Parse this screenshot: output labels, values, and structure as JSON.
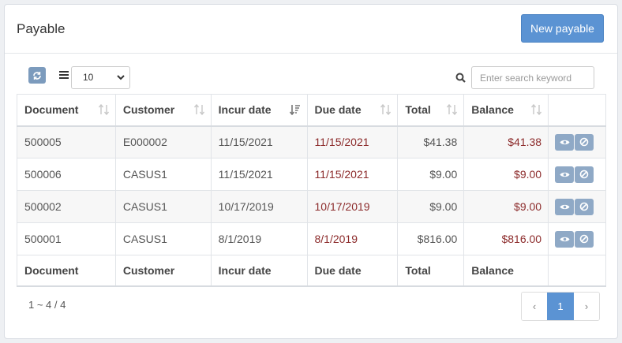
{
  "header": {
    "title": "Payable",
    "new_button_label": "New payable"
  },
  "toolbar": {
    "page_size": "10",
    "search_placeholder": "Enter search keyword"
  },
  "table": {
    "columns": [
      "Document",
      "Customer",
      "Incur date",
      "Due date",
      "Total",
      "Balance"
    ],
    "rows": [
      {
        "document": "500005",
        "customer": "E000002",
        "incur_date": "11/15/2021",
        "due_date": "11/15/2021",
        "total": "$41.38",
        "balance": "$41.38"
      },
      {
        "document": "500006",
        "customer": "CASUS1",
        "incur_date": "11/15/2021",
        "due_date": "11/15/2021",
        "total": "$9.00",
        "balance": "$9.00"
      },
      {
        "document": "500002",
        "customer": "CASUS1",
        "incur_date": "10/17/2019",
        "due_date": "10/17/2019",
        "total": "$9.00",
        "balance": "$9.00"
      },
      {
        "document": "500001",
        "customer": "CASUS1",
        "incur_date": "8/1/2019",
        "due_date": "8/1/2019",
        "total": "$816.00",
        "balance": "$816.00"
      }
    ]
  },
  "footer": {
    "count": "1 ~ 4 / 4",
    "prev": "‹",
    "page": "1",
    "next": "›"
  },
  "colors": {
    "accent": "#5b93d3",
    "due_red": "#8c2b2b",
    "action_btn": "#8fa9c6"
  },
  "icons": [
    "refresh-icon",
    "list-icon",
    "chevron-down-icon",
    "search-icon",
    "sort-icon",
    "eye-icon",
    "ban-icon"
  ]
}
